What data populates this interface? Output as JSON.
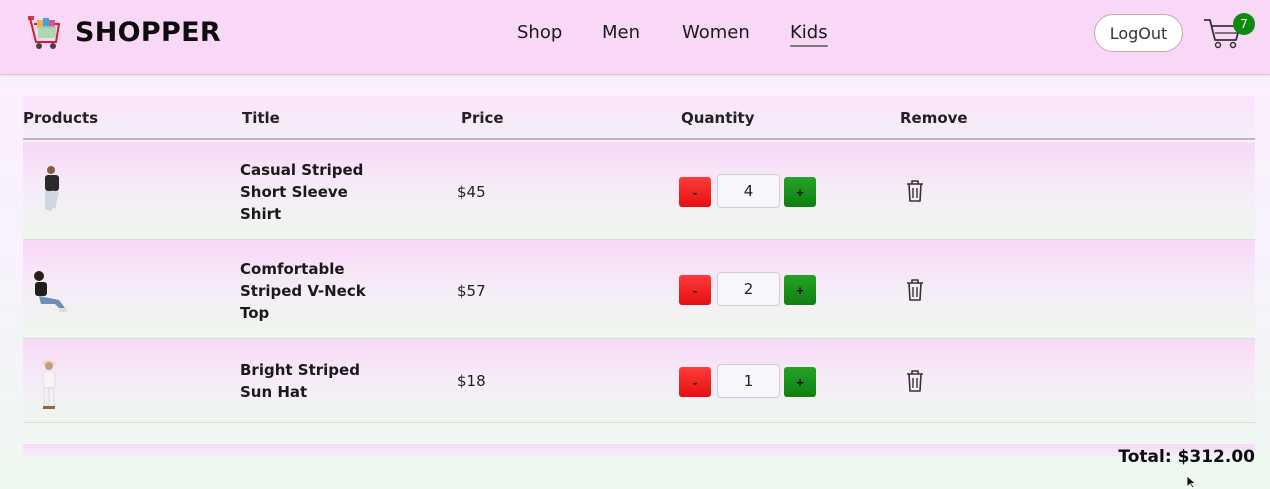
{
  "brand": {
    "name": "SHOPPER",
    "logo_icon": "shopping-cart-logo-icon"
  },
  "nav": {
    "items": [
      {
        "label": "Shop",
        "active": false
      },
      {
        "label": "Men",
        "active": false
      },
      {
        "label": "Women",
        "active": false
      },
      {
        "label": "Kids",
        "active": true
      }
    ]
  },
  "auth": {
    "logout_label": "LogOut"
  },
  "cart_icon": {
    "name": "cart-icon",
    "count": "7",
    "badge_color": "#0f8a0f"
  },
  "table": {
    "headers": [
      "Products",
      "Title",
      "Price",
      "Quantity",
      "Remove"
    ],
    "rows": [
      {
        "title": "Casual Striped Short Sleeve Shirt",
        "price": "$45",
        "quantity": "4",
        "minus": "-",
        "plus": "+",
        "remove_icon": "trash-icon"
      },
      {
        "title": "Comfortable Striped V-Neck Top",
        "price": "$57",
        "quantity": "2",
        "minus": "-",
        "plus": "+",
        "remove_icon": "trash-icon"
      },
      {
        "title": "Bright Striped Sun Hat",
        "price": "$18",
        "quantity": "1",
        "minus": "-",
        "plus": "+",
        "remove_icon": "trash-icon"
      }
    ]
  },
  "total_text": "Total: $312.00",
  "colors": {
    "navbar_bg": "#f8d8f6",
    "minus_button": "#e41010",
    "plus_button": "#0f7f0f"
  }
}
